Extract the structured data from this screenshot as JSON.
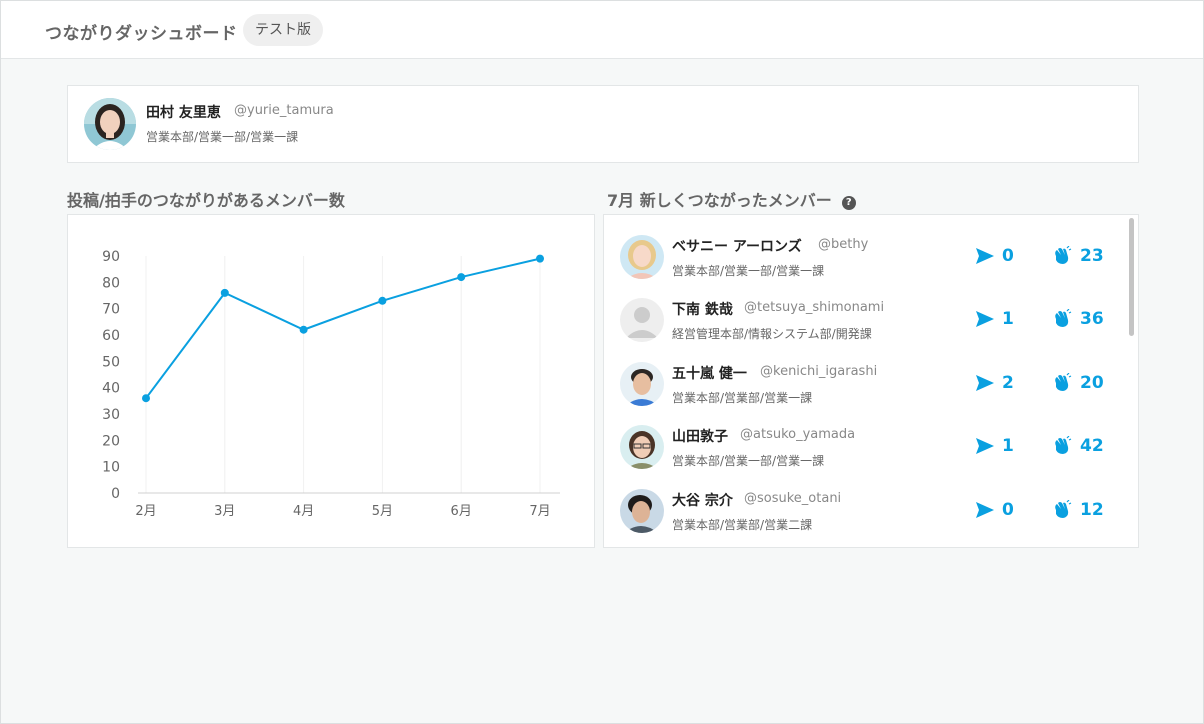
{
  "header": {
    "title": "つながりダッシュボード",
    "badge": "テスト版"
  },
  "profile": {
    "name": "田村 友里恵",
    "handle": "@yurie_tamura",
    "department": "営業本部/営業一部/営業一課"
  },
  "chart_section": {
    "title": "投稿/拍手のつながりがあるメンバー数"
  },
  "members_section": {
    "title": "7月 新しくつながったメンバー",
    "help_icon": "question-circle-icon"
  },
  "chart_data": {
    "type": "line",
    "categories": [
      "2月",
      "3月",
      "4月",
      "5月",
      "6月",
      "7月"
    ],
    "values": [
      36,
      76,
      62,
      73,
      82,
      89
    ],
    "ylim": [
      0,
      90
    ],
    "yticks": [
      0,
      10,
      20,
      30,
      40,
      50,
      60,
      70,
      80,
      90
    ],
    "color": "#0aa0e0",
    "grid": "vertical"
  },
  "members": [
    {
      "name": "ベサニー アーロンズ",
      "handle": "@bethy",
      "department": "営業本部/営業一部/営業一課",
      "posts": "0",
      "claps": "23",
      "avatar": "blonde-woman"
    },
    {
      "name": "下南 鉄哉",
      "handle": "@tetsuya_shimonami",
      "department": "経営管理本部/情報システム部/開発課",
      "posts": "1",
      "claps": "36",
      "avatar": "default-person"
    },
    {
      "name": "五十嵐 健一",
      "handle": "@kenichi_igarashi",
      "department": "営業本部/営業部/営業一課",
      "posts": "2",
      "claps": "20",
      "avatar": "man-smiling"
    },
    {
      "name": "山田敦子",
      "handle": "@atsuko_yamada",
      "department": "営業本部/営業一部/営業一課",
      "posts": "1",
      "claps": "42",
      "avatar": "woman-glasses"
    },
    {
      "name": "大谷 宗介",
      "handle": "@sosuke_otani",
      "department": "営業本部/営業部/営業二課",
      "posts": "0",
      "claps": "12",
      "avatar": "man-dark-hair"
    }
  ],
  "colors": {
    "accent": "#0aa0e0",
    "background": "#f6f8f8"
  }
}
